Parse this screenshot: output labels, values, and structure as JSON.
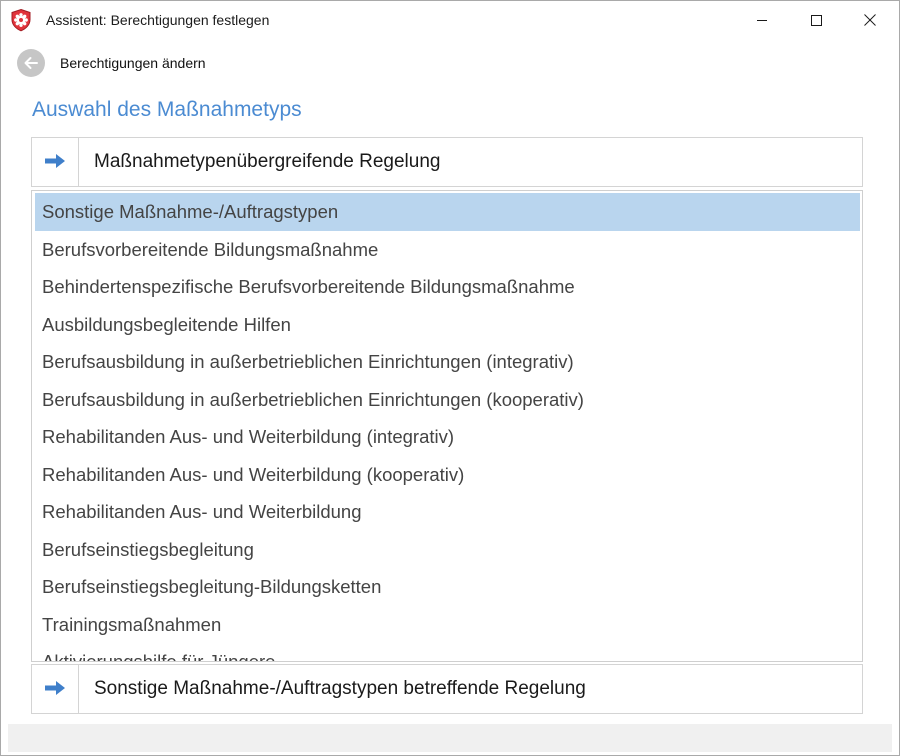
{
  "window": {
    "title": "Assistent: Berechtigungen festlegen",
    "icon": "shield-gear-icon",
    "controls": {
      "minimize": "minimize-icon",
      "maximize": "maximize-icon",
      "close": "close-icon"
    }
  },
  "nav": {
    "back_icon": "arrow-left-icon",
    "label": "Berechtigungen ändern"
  },
  "heading": "Auswahl des Maßnahmetyps",
  "top_link": {
    "icon": "arrow-right-icon",
    "label": "Maßnahmetypenübergreifende Regelung"
  },
  "list": {
    "items": [
      {
        "label": "Sonstige Maßnahme-/Auftragstypen",
        "selected": true
      },
      {
        "label": "Berufsvorbereitende Bildungsmaßnahme",
        "selected": false
      },
      {
        "label": "Behindertenspezifische Berufsvorbereitende Bildungsmaßnahme",
        "selected": false
      },
      {
        "label": "Ausbildungsbegleitende Hilfen",
        "selected": false
      },
      {
        "label": "Berufsausbildung in außerbetrieblichen Einrichtungen (integrativ)",
        "selected": false
      },
      {
        "label": "Berufsausbildung in außerbetrieblichen Einrichtungen (kooperativ)",
        "selected": false
      },
      {
        "label": "Rehabilitanden Aus- und Weiterbildung (integrativ)",
        "selected": false
      },
      {
        "label": "Rehabilitanden Aus- und Weiterbildung (kooperativ)",
        "selected": false
      },
      {
        "label": "Rehabilitanden Aus- und Weiterbildung",
        "selected": false
      },
      {
        "label": "Berufseinstiegsbegleitung",
        "selected": false
      },
      {
        "label": "Berufseinstiegsbegleitung-Bildungsketten",
        "selected": false
      },
      {
        "label": "Trainingsmaßnahmen",
        "selected": false
      },
      {
        "label": "Aktivierungshilfe für Jüngere",
        "selected": false
      }
    ]
  },
  "bottom_link": {
    "icon": "arrow-right-icon",
    "label": "Sonstige Maßnahme-/Auftragstypen betreffende Regelung"
  },
  "colors": {
    "heading": "#4b8bd2",
    "arrow": "#3f7fca",
    "selection": "#b9d5ee",
    "back_button": "#c6c6c6",
    "title_icon": "#e1333b"
  }
}
